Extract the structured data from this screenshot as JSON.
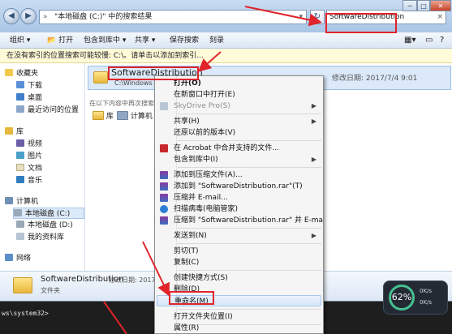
{
  "address_path": "\"本地磁盘 (C:)\" 中的搜索结果",
  "search_value": "SoftwareDistribution",
  "window_controls": {
    "min": "─",
    "max": "□",
    "close": "✕"
  },
  "toolbar": {
    "organize": "组织 ▾",
    "open": "打开",
    "include_lib": "包含到库中 ▾",
    "share": "共享 ▾",
    "save_search": "保存搜索",
    "burn": "刻录"
  },
  "infobar_text": "在没有索引的位置搜索可能较慢: C:\\。请单击以添加到索引...",
  "nav": {
    "favorites": "收藏夹",
    "downloads": "下载",
    "desktop": "桌面",
    "recent": "最近访问的位置",
    "libraries": "库",
    "videos": "视频",
    "pictures": "图片",
    "documents": "文档",
    "music": "音乐",
    "computer": "计算机",
    "drive_c": "本地磁盘 (C:)",
    "drive_d": "本地磁盘 (D:)",
    "my_data": "我的资料库",
    "network": "网络"
  },
  "result": {
    "name": "SoftwareDistribution",
    "path": "C:\\Windows",
    "date": "修改日期: 2017/7/4 9:01",
    "search_again": "在以下内容中再次搜索:",
    "search_lib": "库",
    "search_computer": "计算机"
  },
  "details": {
    "name": "SoftwareDistribution",
    "date_label": "修改日期: 2017/7...",
    "type": "文件夹"
  },
  "context_menu": {
    "open": "打开(O)",
    "open_new_window": "在新窗口中打开(E)",
    "skydrive": "SkyDrive Pro(S)",
    "share": "共享(H)",
    "restore": "还原以前的版本(V)",
    "acrobat": "在 Acrobat 中合并支持的文件...",
    "include_lib": "包含到库中(I)",
    "add_archive": "添加到压缩文件(A)...",
    "add_rar": "添加到 \"SoftwareDistribution.rar\"(T)",
    "compress_email": "压缩并 E-mail...",
    "scan": "扫描病毒(电脑管家)",
    "compress_rar_email": "压缩到 \"SoftwareDistribution.rar\" 并 E-mail",
    "send_to": "发送到(N)",
    "cut": "剪切(T)",
    "copy": "复制(C)",
    "shortcut": "创建快捷方式(S)",
    "delete": "删除(D)",
    "rename": "重命名(M)",
    "open_location": "打开文件夹位置(I)",
    "properties": "属性(R)"
  },
  "console_text": "ws\\system32>",
  "widget": {
    "percent": "62%",
    "up": "0K/s",
    "down": "0K/s"
  },
  "colors": {
    "highlight_box": "#e0242a",
    "title_bg": "#a9c5e6"
  }
}
